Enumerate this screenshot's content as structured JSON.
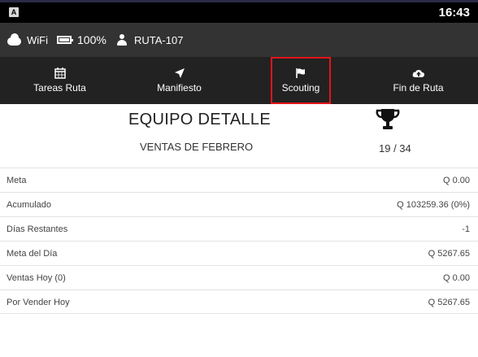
{
  "status_bar": {
    "app_icon_letter": "A",
    "time": "16:43"
  },
  "info_bar": {
    "network": "WiFi",
    "battery": "100%",
    "battery_level": 1.0,
    "route": "RUTA-107"
  },
  "tabs": [
    {
      "label": "Tareas Ruta",
      "icon": "calendar-icon"
    },
    {
      "label": "Manifiesto",
      "icon": "navigation-arrow-icon"
    },
    {
      "label": "Scouting",
      "icon": "flag-icon",
      "highlighted": true
    },
    {
      "label": "Fin de Ruta",
      "icon": "cloud-upload-icon"
    }
  ],
  "highlight_color": "#e3151a",
  "header": {
    "title": "EQUIPO DETALLE",
    "subtitle": "VENTAS DE FEBRERO",
    "rank": "19 / 34",
    "icon": "trophy-icon"
  },
  "rows": [
    {
      "label": "Meta",
      "value": "Q 0.00"
    },
    {
      "label": "Acumulado",
      "value": "Q 103259.36 (0%)"
    },
    {
      "label": "Días Restantes",
      "value": "-1"
    },
    {
      "label": "Meta del Día",
      "value": "Q 5267.65"
    },
    {
      "label": "Ventas Hoy (0)",
      "value": "Q 0.00"
    },
    {
      "label": "Por Vender Hoy",
      "value": "Q 5267.65"
    }
  ]
}
